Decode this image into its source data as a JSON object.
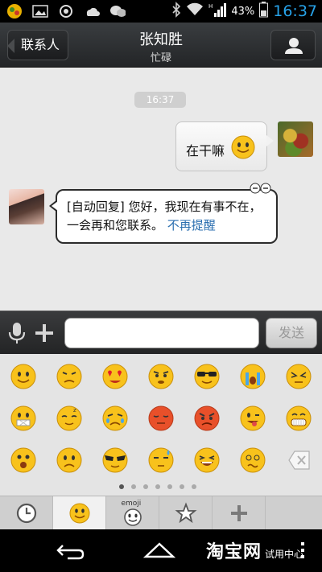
{
  "status_bar": {
    "battery_percent": "43%",
    "time": "16:37",
    "icons": [
      "game-icon",
      "gallery-icon",
      "record-icon",
      "weather-icon",
      "wechat-icon",
      "bluetooth-icon",
      "wifi-icon",
      "signal-icon",
      "battery-icon"
    ]
  },
  "header": {
    "back_label": "联系人",
    "contact_name": "张知胜",
    "contact_status": "忙碌"
  },
  "chat": {
    "timestamp": "16:37",
    "messages": [
      {
        "sender": "me",
        "text": "在干嘛",
        "emoji": "smile"
      },
      {
        "sender": "other",
        "text": "[自动回复] 您好，我现在有事不在，一会再和您联系。",
        "link_text": "不再提醒"
      }
    ]
  },
  "input_bar": {
    "input_value": "",
    "send_label": "发送"
  },
  "emoji_panel": {
    "current_page": 1,
    "page_count": 7
  },
  "tabs": [
    {
      "name": "recent",
      "icon": "clock-icon"
    },
    {
      "name": "default-emoji",
      "icon": "smiley-icon",
      "selected": true
    },
    {
      "name": "emoji",
      "label": "emoji"
    },
    {
      "name": "favorites",
      "icon": "star-icon"
    },
    {
      "name": "add",
      "icon": "plus-icon"
    }
  ],
  "watermark": {
    "brand": "淘宝网",
    "subtitle": "试用中心"
  },
  "colors": {
    "time_accent": "#27a2e8",
    "link": "#2b6fb0",
    "chat_bg": "#e9e9e9"
  }
}
